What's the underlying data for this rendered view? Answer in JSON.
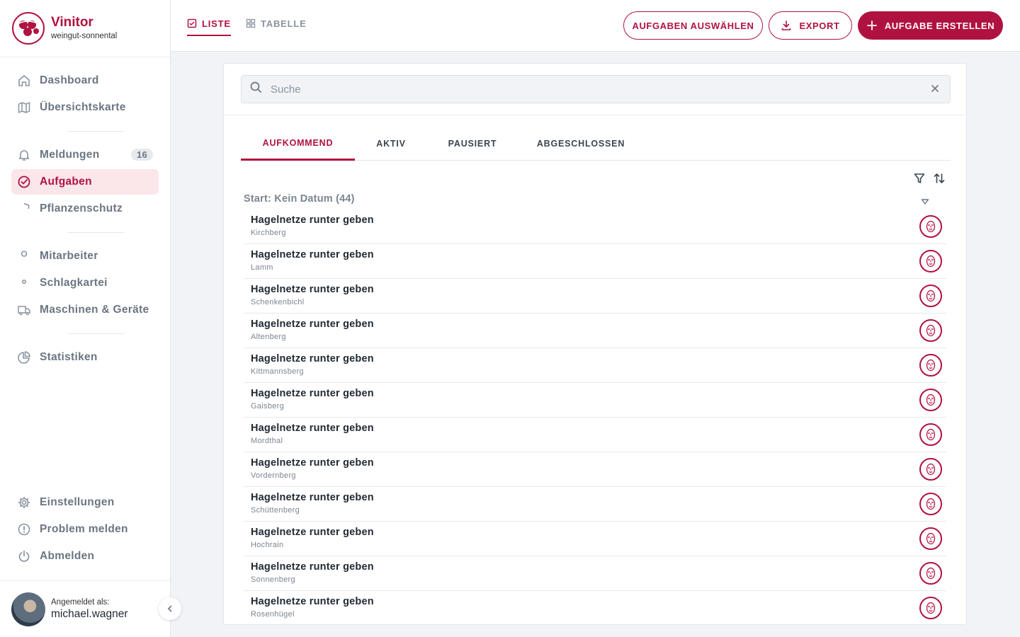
{
  "brand": {
    "name": "Vinitor",
    "subtitle": "weingut-sonnental"
  },
  "sidebar": {
    "groups": [
      [
        {
          "label": "Dashboard",
          "icon": "home-icon"
        },
        {
          "label": "Übersichtskarte",
          "icon": "map-icon"
        }
      ],
      [
        {
          "label": "Meldungen",
          "icon": "bell-icon",
          "badge": "16"
        },
        {
          "label": "Aufgaben",
          "icon": "check-circle-icon",
          "active": true
        },
        {
          "label": "Pflanzenschutz",
          "icon": "shield-icon"
        }
      ],
      [
        {
          "label": "Mitarbeiter",
          "icon": "user-icon"
        },
        {
          "label": "Schlagkartei",
          "icon": "map-pin-icon"
        },
        {
          "label": "Maschinen & Geräte",
          "icon": "truck-icon"
        }
      ],
      [
        {
          "label": "Statistiken",
          "icon": "pie-chart-icon"
        }
      ]
    ],
    "bottom": [
      {
        "label": "Einstellungen",
        "icon": "gear-icon"
      },
      {
        "label": "Problem melden",
        "icon": "alert-circle-icon"
      },
      {
        "label": "Abmelden",
        "icon": "power-icon"
      }
    ]
  },
  "user": {
    "label": "Angemeldet als:",
    "name": "michael.wagner"
  },
  "topbar": {
    "view_tabs": [
      {
        "label": "LISTE",
        "active": true
      },
      {
        "label": "TABELLE",
        "active": false
      }
    ],
    "select_label": "AUFGABEN AUSWÄHLEN",
    "export_label": "EXPORT",
    "create_label": "AUFGABE ERSTELLEN"
  },
  "search": {
    "placeholder": "Suche",
    "value": ""
  },
  "tabs": [
    {
      "label": "AUFKOMMEND",
      "active": true
    },
    {
      "label": "AKTIV",
      "active": false
    },
    {
      "label": "PAUSIERT",
      "active": false
    },
    {
      "label": "ABGESCHLOSSEN",
      "active": false
    }
  ],
  "group": {
    "title": "Start: Kein Datum (44)"
  },
  "tasks": [
    {
      "title": "Hagelnetze runter geben",
      "location": "Kirchberg"
    },
    {
      "title": "Hagelnetze runter geben",
      "location": "Lamm"
    },
    {
      "title": "Hagelnetze runter geben",
      "location": "Schenkenbichl"
    },
    {
      "title": "Hagelnetze runter geben",
      "location": "Altenberg"
    },
    {
      "title": "Hagelnetze runter geben",
      "location": "Kittmannsberg"
    },
    {
      "title": "Hagelnetze runter geben",
      "location": "Gaisberg"
    },
    {
      "title": "Hagelnetze runter geben",
      "location": "Mordthal"
    },
    {
      "title": "Hagelnetze runter geben",
      "location": "Vordernberg"
    },
    {
      "title": "Hagelnetze runter geben",
      "location": "Schüttenberg"
    },
    {
      "title": "Hagelnetze runter geben",
      "location": "Hochrain"
    },
    {
      "title": "Hagelnetze runter geben",
      "location": "Sonnenberg"
    },
    {
      "title": "Hagelnetze runter geben",
      "location": "Rosenhügel"
    }
  ],
  "colors": {
    "accent": "#b0123f",
    "accent_soft": "#fbe6ea",
    "muted": "#6b7682"
  }
}
